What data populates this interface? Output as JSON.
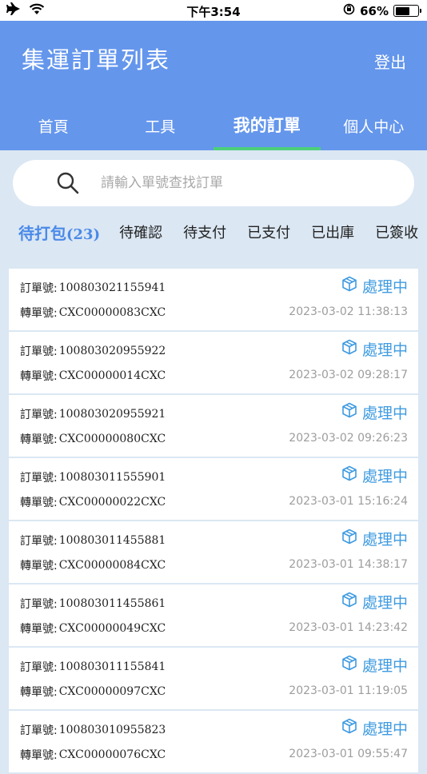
{
  "status_bar": {
    "time": "下午3:54",
    "battery": "66%",
    "battery_level": 0.66
  },
  "header": {
    "title": "集運訂單列表",
    "logout_label": "登出"
  },
  "nav_tabs": [
    {
      "label": "首頁",
      "active": false
    },
    {
      "label": "工具",
      "active": false
    },
    {
      "label": "我的訂單",
      "active": true
    },
    {
      "label": "個人中心",
      "active": false
    }
  ],
  "search": {
    "placeholder": "請輸入單號查找訂單"
  },
  "filters": {
    "pending_pack_label": "待打包",
    "pending_pack_count": "(23)",
    "pending_confirm": "待確認",
    "pending_payment": "待支付",
    "paid": "已支付",
    "shipped": "已出庫",
    "signed": "已簽收"
  },
  "labels": {
    "order_no": "訂單號:",
    "transfer_no": "轉單號:"
  },
  "orders": [
    {
      "order_no": "100803021155941",
      "transfer_no": "CXC00000083CXC",
      "status": "處理中",
      "time": "2023-03-02 11:38:13"
    },
    {
      "order_no": "100803020955922",
      "transfer_no": "CXC00000014CXC",
      "status": "處理中",
      "time": "2023-03-02 09:28:17"
    },
    {
      "order_no": "100803020955921",
      "transfer_no": "CXC00000080CXC",
      "status": "處理中",
      "time": "2023-03-02 09:26:23"
    },
    {
      "order_no": "100803011555901",
      "transfer_no": "CXC00000022CXC",
      "status": "處理中",
      "time": "2023-03-01 15:16:24"
    },
    {
      "order_no": "100803011455881",
      "transfer_no": "CXC00000084CXC",
      "status": "處理中",
      "time": "2023-03-01 14:38:17"
    },
    {
      "order_no": "100803011455861",
      "transfer_no": "CXC00000049CXC",
      "status": "處理中",
      "time": "2023-03-01 14:23:42"
    },
    {
      "order_no": "100803011155841",
      "transfer_no": "CXC00000097CXC",
      "status": "處理中",
      "time": "2023-03-01 11:19:05"
    },
    {
      "order_no": "100803010955823",
      "transfer_no": "CXC00000076CXC",
      "status": "處理中",
      "time": "2023-03-01 09:55:47"
    }
  ]
}
